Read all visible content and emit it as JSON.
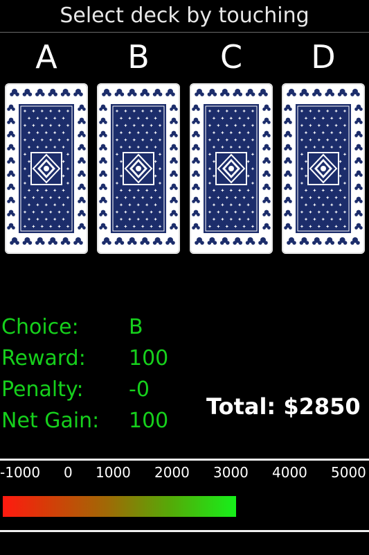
{
  "header": {
    "title": "Select deck by touching"
  },
  "decks": [
    {
      "letter": "A"
    },
    {
      "letter": "B"
    },
    {
      "letter": "C"
    },
    {
      "letter": "D"
    }
  ],
  "stats": {
    "choice_label": "Choice:",
    "choice_value": "B",
    "reward_label": "Reward:",
    "reward_value": "100",
    "penalty_label": "Penalty:",
    "penalty_value": "-0",
    "net_label": "Net Gain:",
    "net_value": "100"
  },
  "total": {
    "text": "Total: $2850",
    "value": 2850
  },
  "scale": {
    "ticks": [
      "-1000",
      "0",
      "1000",
      "2000",
      "3000",
      "4000",
      "5000"
    ],
    "min": -1000,
    "max": 5000
  },
  "colors": {
    "stat_text": "#16d01c",
    "card_back": "#1c2d6b",
    "bar_start": "#ff1a10",
    "bar_end": "#16f01a"
  },
  "icons": {
    "card_back": "card-back-pattern"
  }
}
